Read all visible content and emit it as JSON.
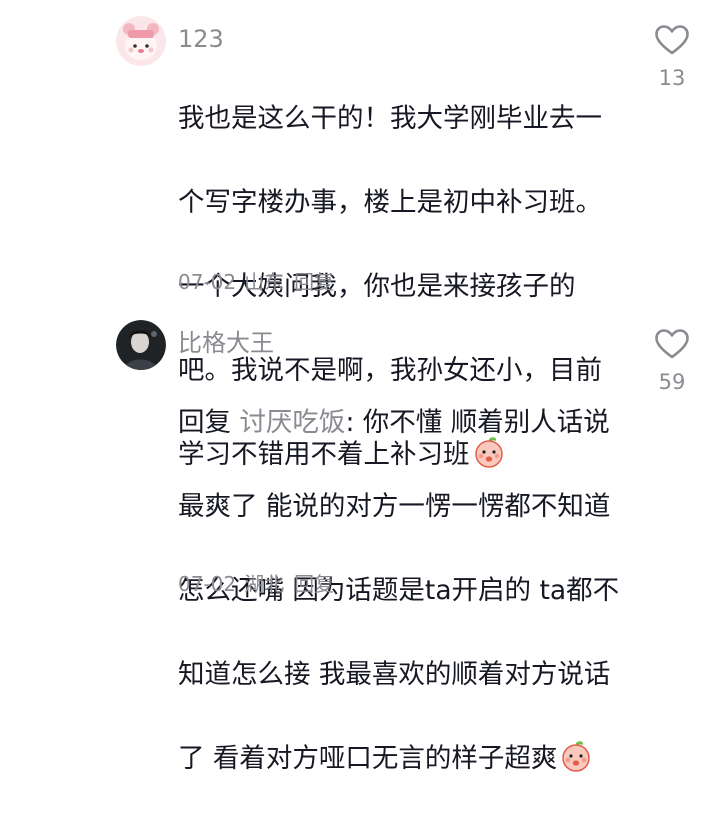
{
  "comments": [
    {
      "username": "123",
      "lines": [
        "我也是这么干的！我大学刚毕业去一",
        "个写字楼办事，楼上是初中补习班。",
        "一个大姨问我，你也是来接孩子的",
        "吧。我说不是啊，我孙女还小，目前",
        "学习不错用不着上补习班"
      ],
      "date": "07-02",
      "location": "山东",
      "reply_label": "回复",
      "like_count": "13",
      "avatar_icon": "pink-bear-avatar-icon",
      "emoji_icon": "peach-face-emoji-icon"
    },
    {
      "username": "比格大王",
      "reply_prefix": "回复",
      "reply_target": "讨厌吃饭",
      "reply_colon": ": ",
      "lines": [
        "你不懂 顺着别人话说",
        "最爽了 能说的对方一愣一愣都不知道",
        "怎么还嘴 因为话题是ta开启的 ta都不",
        "知道怎么接 我最喜欢的顺着对方说话",
        "了 看着对方哑口无言的样子超爽"
      ],
      "date": "07-02",
      "location": "湖北",
      "reply_label": "回复",
      "like_count": "59",
      "avatar_icon": "dark-photo-avatar-icon",
      "emoji_icon": "peach-face-emoji-icon"
    }
  ],
  "colors": {
    "text": "#161823",
    "muted": "#8a8b91",
    "heart_stroke": "#8a8b91"
  }
}
